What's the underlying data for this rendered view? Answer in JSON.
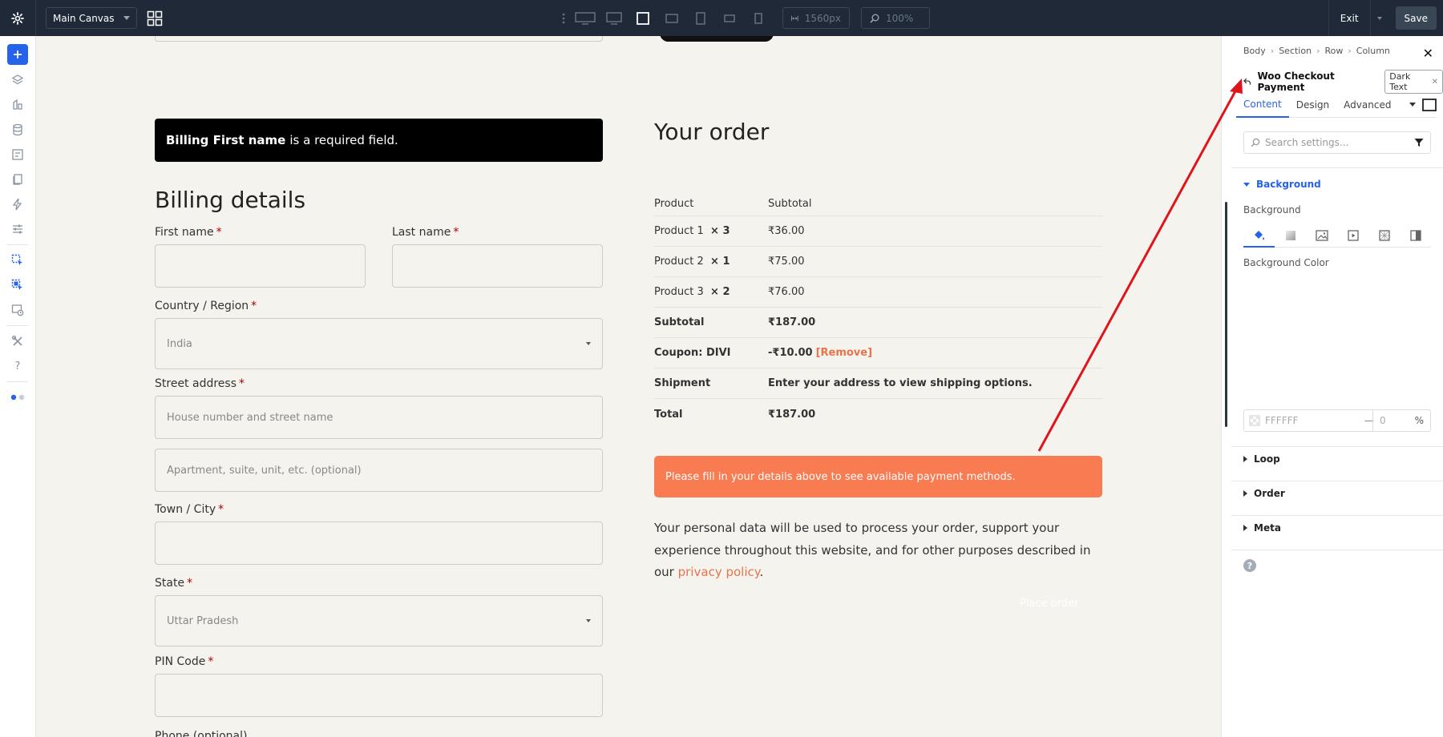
{
  "topbar": {
    "canvas_select": "Main Canvas",
    "width_value": "1560px",
    "zoom_value": "100%",
    "exit_label": "Exit",
    "save_label": "Save"
  },
  "canvas": {
    "notice_bold": "Billing First name",
    "notice_rest": "is a required field.",
    "billing_heading": "Billing details",
    "fields": {
      "first_name": "First name",
      "last_name": "Last name",
      "country": "Country / Region",
      "country_value": "India",
      "street": "Street address",
      "street_placeholder": "House number and street name",
      "apartment_placeholder": "Apartment, suite, unit, etc. (optional)",
      "town": "Town / City",
      "state": "State",
      "state_value": "Uttar Pradesh",
      "pin": "PIN Code",
      "phone": "Phone (optional)",
      "required_mark": "*"
    },
    "order_heading": "Your order",
    "order_head": [
      "Product",
      "Subtotal"
    ],
    "order_rows": [
      {
        "product": "Product 1",
        "qty": "× 3",
        "subtotal": "₹36.00"
      },
      {
        "product": "Product 2",
        "qty": "× 1",
        "subtotal": "₹75.00"
      },
      {
        "product": "Product 3",
        "qty": "× 2",
        "subtotal": "₹76.00"
      }
    ],
    "totals": {
      "subtotal_label": "Subtotal",
      "subtotal_value": "₹187.00",
      "coupon_label": "Coupon: DIVI",
      "coupon_value": "-₹10.00",
      "coupon_remove": "[Remove]",
      "shipment_label": "Shipment",
      "shipment_value": "Enter your address to view shipping options.",
      "total_label": "Total",
      "total_value": "₹187.00"
    },
    "payment_notice": "Please fill in your details above to see available payment methods.",
    "privacy_text": "Your personal data will be used to process your order, support your experience throughout this website, and for other purposes described in our",
    "privacy_link": "privacy policy",
    "privacy_end": ".",
    "place_order": "Place order"
  },
  "panel": {
    "breadcrumb": [
      "Body",
      "Section",
      "Row",
      "Column"
    ],
    "module_title": "Woo Checkout Payment",
    "preset_badge": "Dark Text",
    "tabs": [
      "Content",
      "Design",
      "Advanced"
    ],
    "search_placeholder": "Search settings...",
    "background_section": "Background",
    "background_label": "Background",
    "background_color_label": "Background Color",
    "color_hex_placeholder": "FFFFFF",
    "color_opacity_placeholder": "0",
    "opacity_unit": "%",
    "sections": [
      "Loop",
      "Order",
      "Meta"
    ],
    "help": "?"
  },
  "colors": {
    "accent": "#2563eb",
    "topbar": "#1f2937",
    "payment_notice": "#f97b52",
    "annotation_arrow": "#e0141b"
  }
}
